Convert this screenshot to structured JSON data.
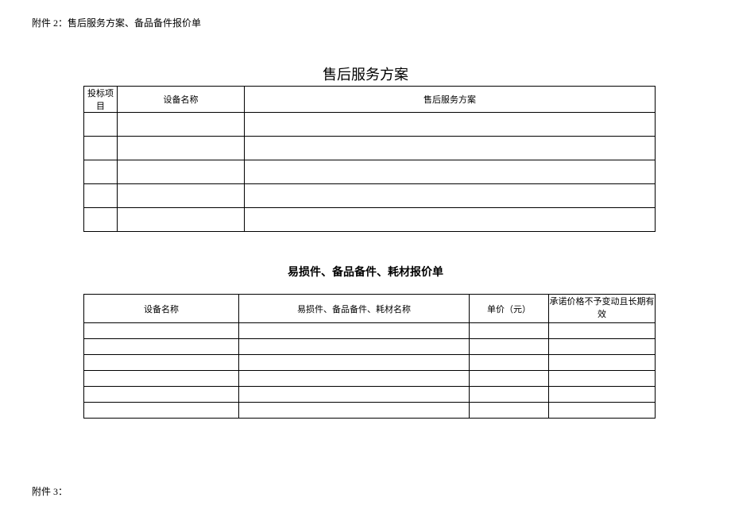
{
  "header_label": "附件 2：售后服务方案、备品备件报价单",
  "section1": {
    "title": "售后服务方案",
    "headers": {
      "col1": "投标项目",
      "col2": "设备名称",
      "col3": "售后服务方案"
    },
    "row_count": 5
  },
  "section2": {
    "title": "易损件、备品备件、耗材报价单",
    "headers": {
      "col1": "设备名称",
      "col2": "易损件、备品备件、耗材名称",
      "col3": "单价（元）",
      "col4": "承诺价格不予变动且长期有效"
    },
    "row_count": 6
  },
  "footer_label": "附件 3："
}
